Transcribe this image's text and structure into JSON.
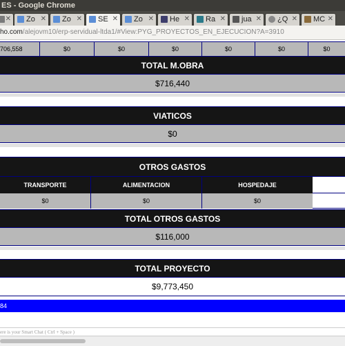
{
  "window": {
    "title": "ES - Google Chrome"
  },
  "tabs": [
    {
      "label": "Zo",
      "icon": "zoho-icon"
    },
    {
      "label": "Zo",
      "icon": "zoho-icon"
    },
    {
      "label": "SE",
      "icon": "zoho-icon",
      "active": true
    },
    {
      "label": "Zo",
      "icon": "zoho-icon"
    },
    {
      "label": "He",
      "icon": "help-icon"
    },
    {
      "label": "Ra",
      "icon": "rails-icon"
    },
    {
      "label": "jua",
      "icon": "hash-icon"
    },
    {
      "label": "¿Q",
      "icon": "stack-icon"
    },
    {
      "label": "MC",
      "icon": "crown-icon"
    }
  ],
  "address": {
    "host": "ho.com",
    "path": "/alejovm10/erp-servidual-ltda1/#View:PYG_PROYECTOS_EN_EJECUCION?A=3910"
  },
  "top_values": [
    "706,558",
    "$0",
    "$0",
    "$0",
    "$0",
    "$0",
    "$0"
  ],
  "mobra": {
    "header": "TOTAL M.OBRA",
    "value": "$716,440"
  },
  "viaticos": {
    "header": "VIATICOS",
    "value": "$0"
  },
  "otros": {
    "header": "OTROS GASTOS",
    "columns": [
      "TRANSPORTE",
      "ALIMENTACION",
      "HOSPEDAJE",
      ""
    ],
    "values": [
      "$0",
      "$0",
      "$0",
      ""
    ]
  },
  "total_otros": {
    "header": "TOTAL OTROS GASTOS",
    "value": "$116,000"
  },
  "total_proyecto": {
    "header": "TOTAL PROYECTO",
    "value": "$9,773,450"
  },
  "blue_bar_text": "84",
  "chat": {
    "placeholder": "ere is your Smart Chat ( Ctrl + Space )"
  },
  "colors": {
    "header_bg": "#151515",
    "value_bg": "#b8b8b8",
    "border": "#000080",
    "blue_bar": "#0000ff"
  }
}
